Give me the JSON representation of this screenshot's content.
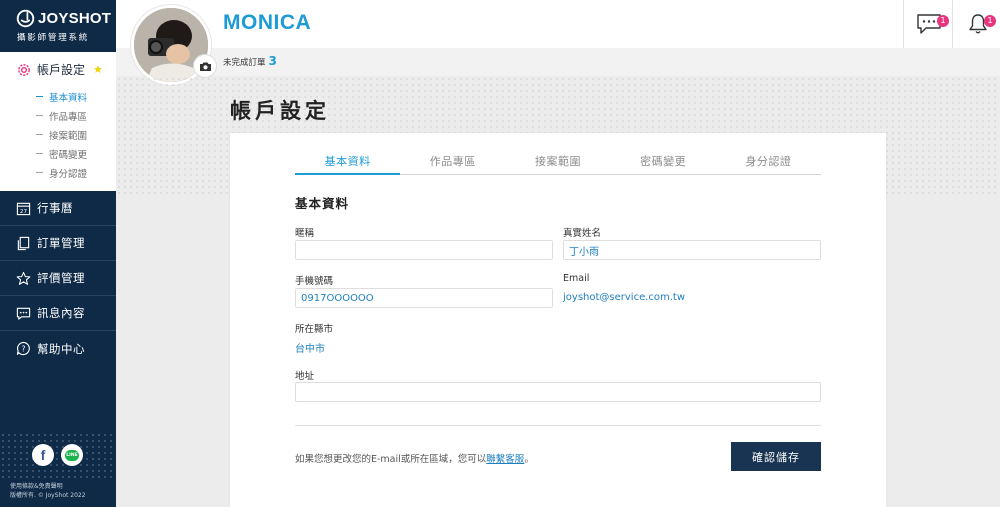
{
  "brand": {
    "name": "JOYSHOT",
    "subtitle": "攝影師管理系統"
  },
  "account_menu": {
    "title": "帳戶設定",
    "items": [
      {
        "label": "基本資料",
        "active": true
      },
      {
        "label": "作品專區",
        "active": false
      },
      {
        "label": "接案範圍",
        "active": false
      },
      {
        "label": "密碼變更",
        "active": false
      },
      {
        "label": "身分認證",
        "active": false
      }
    ]
  },
  "nav": [
    {
      "label": "行事曆",
      "icon": "calendar-icon"
    },
    {
      "label": "訂單管理",
      "icon": "order-icon"
    },
    {
      "label": "評價管理",
      "icon": "star-icon"
    },
    {
      "label": "訊息內容",
      "icon": "chat-icon"
    },
    {
      "label": "幫助中心",
      "icon": "help-icon"
    }
  ],
  "social": {
    "line_label": "LINE"
  },
  "footer": {
    "line1": "使用條款&免責聲明",
    "line2": "版權所有. © JoyShot 2022"
  },
  "header": {
    "user_name": "MONICA",
    "pending_label": "未完成訂單",
    "pending_count": "3",
    "message_badge": "1",
    "notification_badge": "1"
  },
  "page": {
    "title": "帳戶設定"
  },
  "tabs": [
    "基本資料",
    "作品專區",
    "接案範圍",
    "密碼變更",
    "身分認證"
  ],
  "form": {
    "section_title": "基本資料",
    "nickname_label": "暱稱",
    "nickname_value": "",
    "realname_label": "真實姓名",
    "realname_value": "丁小雨",
    "phone_label": "手機號碼",
    "phone_value": "0917OOOOOO",
    "email_label": "Email",
    "email_value": "joyshot@service.com.tw",
    "city_label": "所在縣市",
    "city_value": "台中市",
    "address_label": "地址",
    "address_value": ""
  },
  "note": {
    "text": "如果您想更改您的E-mail或所在區域，您可以",
    "link": "聯繫客服",
    "suffix": "。"
  },
  "save_button": "確認儲存",
  "colors": {
    "sidebar": "#0e2a47",
    "accent": "#1e9bd6",
    "button": "#183452",
    "badge": "#e8357f"
  }
}
